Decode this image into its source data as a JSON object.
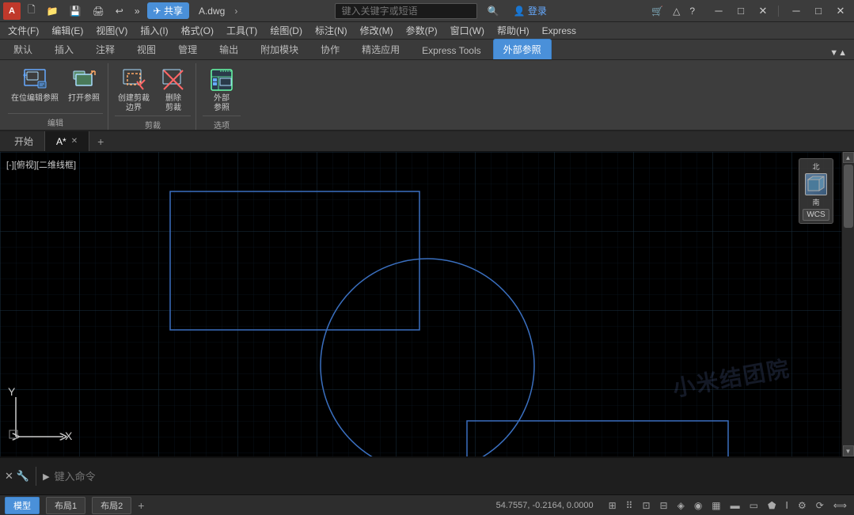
{
  "titlebar": {
    "logo": "A",
    "share_label": "共享",
    "filename": "A.dwg",
    "search_placeholder": "键入关键字或短语",
    "login_label": "登录",
    "min_btn": "─",
    "max_btn": "□",
    "close_btn": "✕",
    "inner_min": "─",
    "inner_max": "□",
    "inner_close": "✕"
  },
  "menubar": {
    "items": [
      {
        "label": "文件(F)"
      },
      {
        "label": "编辑(E)"
      },
      {
        "label": "视图(V)"
      },
      {
        "label": "插入(I)"
      },
      {
        "label": "格式(O)"
      },
      {
        "label": "工具(T)"
      },
      {
        "label": "绘图(D)"
      },
      {
        "label": "标注(N)"
      },
      {
        "label": "修改(M)"
      },
      {
        "label": "参数(P)"
      },
      {
        "label": "窗口(W)"
      },
      {
        "label": "帮助(H)"
      },
      {
        "label": "Express"
      }
    ]
  },
  "ribbon": {
    "tabs": [
      {
        "label": "默认",
        "active": false
      },
      {
        "label": "插入",
        "active": false
      },
      {
        "label": "注释",
        "active": false
      },
      {
        "label": "视图",
        "active": false
      },
      {
        "label": "管理",
        "active": false
      },
      {
        "label": "输出",
        "active": false
      },
      {
        "label": "附加模块",
        "active": false
      },
      {
        "label": "协作",
        "active": false
      },
      {
        "label": "精选应用",
        "active": false
      },
      {
        "label": "Express Tools",
        "active": false
      },
      {
        "label": "外部参照",
        "active": true
      }
    ],
    "groups": [
      {
        "label": "编辑",
        "buttons": [
          {
            "icon": "✎",
            "label": "在位编辑参照",
            "type": "large"
          },
          {
            "icon": "📂",
            "label": "打开参照",
            "type": "large"
          }
        ]
      },
      {
        "label": "剪裁",
        "buttons": [
          {
            "icon": "✂",
            "label": "创建剪裁\n边界",
            "type": "large"
          },
          {
            "icon": "✕",
            "label": "删除\n剪裁",
            "type": "large"
          }
        ]
      },
      {
        "label": "选项",
        "buttons": [
          {
            "icon": "⊞",
            "label": "外部\n参照",
            "type": "large"
          }
        ]
      }
    ]
  },
  "doc_tabs": [
    {
      "label": "开始",
      "active": false,
      "closable": false
    },
    {
      "label": "A*",
      "active": true,
      "closable": true
    }
  ],
  "canvas": {
    "label": "[-][俯视][二维线框]",
    "compass_north": "北",
    "compass_south": "南",
    "wcs_label": "WCS",
    "watermark": "小米结团院"
  },
  "command": {
    "prompt_placeholder": "键入命令",
    "icons": [
      "✕",
      "🔧"
    ]
  },
  "statusbar": {
    "tabs": [
      {
        "label": "模型",
        "active": true
      },
      {
        "label": "布局1",
        "active": false
      },
      {
        "label": "布局2",
        "active": false
      }
    ],
    "add_tab": "+",
    "coords": "54.7557, -0.2164, 0.0000",
    "model_label": "模型",
    "status_icons": [
      "⊞",
      "⠿",
      "▭",
      "⬟",
      "⟳",
      "⟵"
    ]
  }
}
